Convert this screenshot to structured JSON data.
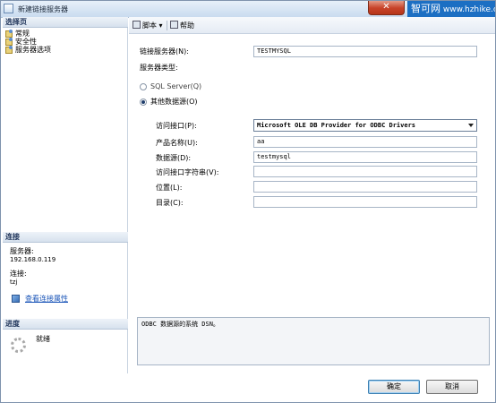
{
  "window": {
    "title": "新建链接服务器",
    "close_glyph": "✕",
    "watermark_cn": "智可网",
    "watermark_url": "www.hzhike.com"
  },
  "left": {
    "select_page_header": "选择页",
    "pages": [
      "常规",
      "安全性",
      "服务器选项"
    ],
    "connection_header": "连接",
    "server_label": "服务器:",
    "server_value": "192.168.0.119",
    "connection_label": "连接:",
    "connection_value": "tzj",
    "view_conn_props": "查看连接属性",
    "progress_header": "进度",
    "progress_status": "就绪"
  },
  "toolbar": {
    "script_label": "脚本",
    "help_label": "帮助"
  },
  "form": {
    "linked_server_label": "链接服务器(N):",
    "linked_server_value": "TESTMYSQL",
    "server_type_label": "服务器类型:",
    "sql_server_label": "SQL Server(Q)",
    "other_source_label": "其他数据源(O)",
    "provider_label": "访问接口(P):",
    "provider_value": "Microsoft OLE DB Provider for ODBC Drivers",
    "product_name_label": "产品名称(U):",
    "product_name_value": "aa",
    "data_source_label": "数据源(D):",
    "data_source_value": "testmysql",
    "provider_string_label": "访问接口字符串(V):",
    "provider_string_value": "",
    "location_label": "位置(L):",
    "location_value": "",
    "catalog_label": "目录(C):",
    "catalog_value": "",
    "description": "ODBC 数据源的系统 DSN。"
  },
  "buttons": {
    "ok": "确定",
    "cancel": "取消"
  }
}
